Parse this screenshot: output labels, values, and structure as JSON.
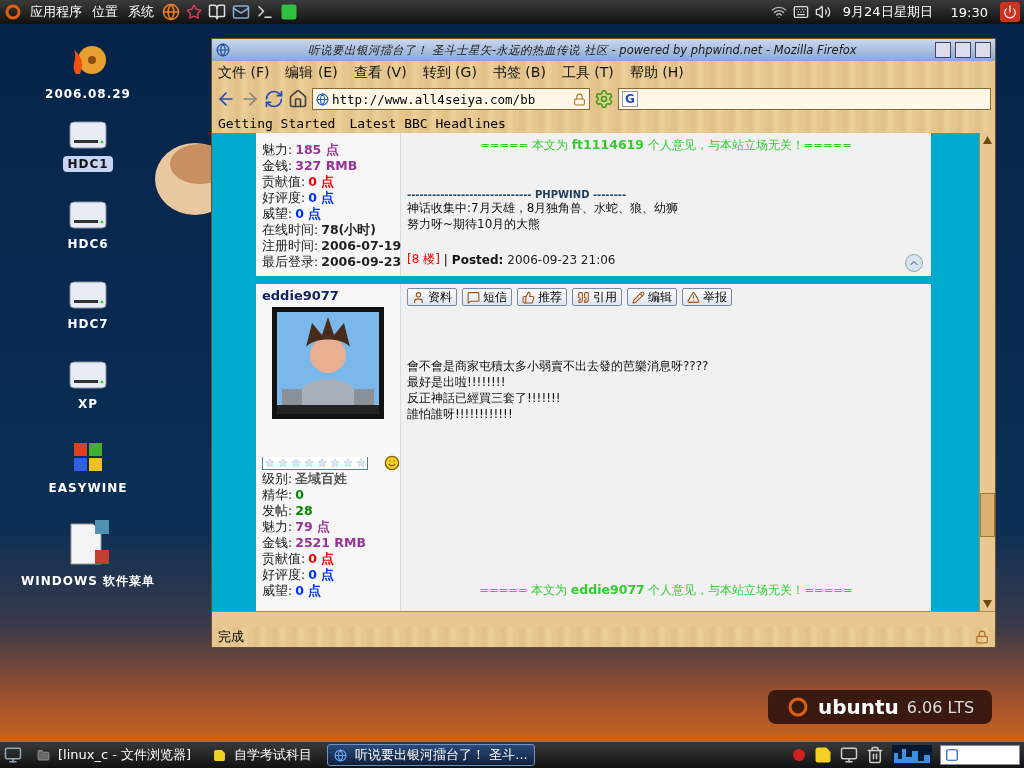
{
  "top_panel": {
    "menus": [
      {
        "label": "应用程序"
      },
      {
        "label": "位置"
      },
      {
        "label": "系统"
      }
    ],
    "date": "9月24日星期日",
    "time": "19:30"
  },
  "desktop_icons": [
    {
      "label": "2006.08.29",
      "kind": "disc",
      "selected": false
    },
    {
      "label": "HDC1",
      "kind": "drive",
      "selected": true
    },
    {
      "label": "HDC6",
      "kind": "drive",
      "selected": false
    },
    {
      "label": "HDC7",
      "kind": "drive",
      "selected": false
    },
    {
      "label": "XP",
      "kind": "drive",
      "selected": false
    },
    {
      "label": "EASYWINE",
      "kind": "windows",
      "selected": false
    },
    {
      "label": "WINDOWS 软件菜单",
      "kind": "document",
      "selected": false
    }
  ],
  "window": {
    "title": "听说要出银河擂台了！ 圣斗士星矢-永远的热血传说 社区 - powered by phpwind.net - Mozilla Firefox",
    "menu": [
      {
        "label": "文件",
        "key": "(F)"
      },
      {
        "label": "编辑",
        "key": "(E)"
      },
      {
        "label": "查看",
        "key": "(V)"
      },
      {
        "label": "转到",
        "key": "(G)"
      },
      {
        "label": "书签",
        "key": "(B)"
      },
      {
        "label": "工具",
        "key": "(T)"
      },
      {
        "label": "帮助",
        "key": "(H)"
      }
    ],
    "address": "http://www.all4seiya.com/bb",
    "search_engine": "G",
    "bookmarks": [
      "Getting Started",
      "Latest BBC Headlines"
    ],
    "status": "完成"
  },
  "posts": [
    {
      "stats": [
        {
          "label": "魅力:",
          "value": "185 点",
          "color": "#993399"
        },
        {
          "label": "金钱:",
          "value": "327 RMB",
          "color": "#993399"
        },
        {
          "label": "贡献值:",
          "value": "0 点",
          "color": "#ff0000"
        },
        {
          "label": "好评度:",
          "value": "0 点",
          "color": "#0033ff"
        },
        {
          "label": "威望:",
          "value": "0 点",
          "color": "#0033ff"
        },
        {
          "label": "在线时间:",
          "value": "78(小时)",
          "color": "#222222"
        },
        {
          "label": "注册时间:",
          "value": "2006-07-19",
          "color": "#222222"
        },
        {
          "label": "最后登录:",
          "value": "2006-09-23",
          "color": "#222222"
        }
      ],
      "disclaimer": "===== 本文为 **ft1114619** 个人意见，与本站立场无关！=====",
      "signature_rule": "------------------------------ PHPWIND --------",
      "signature": [
        "神话收集中:7月天雄，8月独角兽、水蛇、狼、幼狮",
        "努力呀~期待10月的大熊"
      ],
      "floor": "[8 楼]",
      "separator": "|",
      "posted_label": "Posted:",
      "posted": "2006-09-23 21:06"
    },
    {
      "username": "eddie9077",
      "avatar": {
        "kind": "picture"
      },
      "stars": 0,
      "stats": [
        {
          "label": "级别:",
          "value": "圣域百姓",
          "color": "#555555"
        },
        {
          "label": "精华:",
          "value": "0",
          "color": "#008800"
        },
        {
          "label": "发帖:",
          "value": "28",
          "color": "#008800"
        },
        {
          "label": "魅力:",
          "value": "79 点",
          "color": "#993399"
        },
        {
          "label": "金钱:",
          "value": "2521 RMB",
          "color": "#993399"
        },
        {
          "label": "贡献值:",
          "value": "0 点",
          "color": "#ff0000"
        },
        {
          "label": "好评度:",
          "value": "0 点",
          "color": "#0033ff"
        },
        {
          "label": "威望:",
          "value": "0 点",
          "color": "#0033ff"
        }
      ],
      "actions": [
        {
          "label": "资料",
          "kind": "profile"
        },
        {
          "label": "短信",
          "kind": "message"
        },
        {
          "label": "推荐",
          "kind": "recommend"
        },
        {
          "label": "引用",
          "kind": "quote"
        },
        {
          "label": "编辑",
          "kind": "edit"
        },
        {
          "label": "举报",
          "kind": "report"
        }
      ],
      "body": [
        "會不會是商家屯積太多小弱賣不出去發的芭樂消息呀????",
        "最好是出啦!!!!!!!!",
        "反正神話已經買三套了!!!!!!!",
        "誰怕誰呀!!!!!!!!!!!!"
      ],
      "disclaimer": "===== 本文为 **eddie9077** 个人意见，与本站立场无关！====="
    }
  ],
  "taskbar": {
    "tasks": [
      {
        "label": "[linux_c - 文件浏览器]",
        "kind": "folder",
        "selected": false
      },
      {
        "label": "自学考试科目",
        "kind": "note",
        "selected": false
      },
      {
        "label": "听说要出银河擂台了！ 圣斗...",
        "kind": "browser",
        "selected": true
      }
    ]
  },
  "logo": {
    "name": "ubuntu",
    "version": "6.06 LTS"
  }
}
